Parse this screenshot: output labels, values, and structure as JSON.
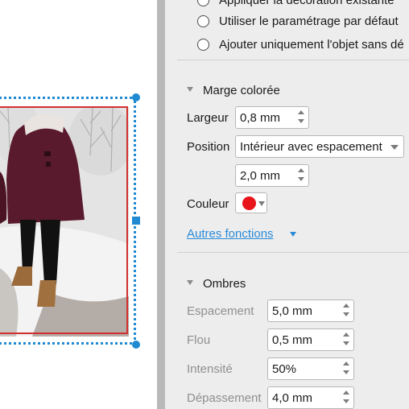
{
  "radio_options": [
    {
      "label": "Appliquer la décoration existante",
      "selected": false
    },
    {
      "label": "Utiliser le paramétrage par défaut",
      "selected": false
    },
    {
      "label": "Ajouter uniquement l'objet sans dé",
      "selected": false
    }
  ],
  "border_section": {
    "title": "Marge colorée",
    "width_label": "Largeur",
    "width_value": "0,8 mm",
    "position_label": "Position",
    "position_value": "Intérieur avec espacement",
    "offset_value": "2,0 mm",
    "color_label": "Couleur",
    "color": "#e8151b"
  },
  "more_link": "Autres fonctions",
  "shadow_section": {
    "title": "Ombres",
    "spacing_label": "Espacement",
    "spacing_value": "5,0 mm",
    "blur_label": "Flou",
    "blur_value": "0,5 mm",
    "intensity_label": "Intensité",
    "intensity_value": "50%",
    "overflow_label": "Dépassement",
    "overflow_value": "4,0 mm"
  },
  "canvas": {
    "selection_color": "#1f8ad2",
    "frame_color": "#d32f2f",
    "photo_description_icon": "photo-icon"
  }
}
